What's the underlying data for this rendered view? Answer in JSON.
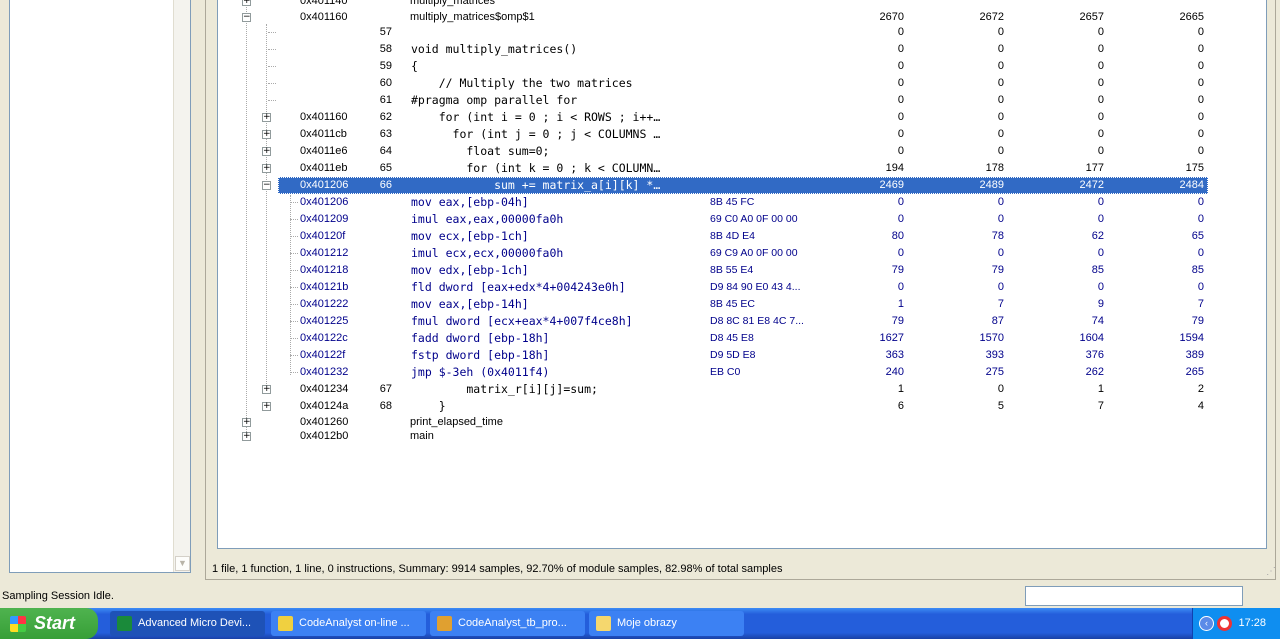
{
  "tree": {
    "columns_note": "",
    "rows": [
      {
        "kind": "func",
        "level": 1,
        "exp": "+",
        "addr": "0x401140",
        "line": "",
        "src": "multiply_matrices",
        "bytes": "",
        "vals": [
          "",
          "",
          "",
          ""
        ]
      },
      {
        "kind": "func",
        "level": 1,
        "exp": "-",
        "addr": "0x401160",
        "line": "",
        "src": "multiply_matrices$omp$1",
        "bytes": "",
        "vals": [
          "2670",
          "2672",
          "2657",
          "2665"
        ]
      },
      {
        "kind": "src",
        "level": 2,
        "exp": "",
        "addr": "",
        "line": "57",
        "src": "",
        "bytes": "",
        "vals": [
          "0",
          "0",
          "0",
          "0"
        ]
      },
      {
        "kind": "src",
        "level": 2,
        "exp": "",
        "addr": "",
        "line": "58",
        "src": "void multiply_matrices()",
        "bytes": "",
        "vals": [
          "0",
          "0",
          "0",
          "0"
        ]
      },
      {
        "kind": "src",
        "level": 2,
        "exp": "",
        "addr": "",
        "line": "59",
        "src": "{",
        "bytes": "",
        "vals": [
          "0",
          "0",
          "0",
          "0"
        ]
      },
      {
        "kind": "src",
        "level": 2,
        "exp": "",
        "addr": "",
        "line": "60",
        "src": "    // Multiply the two matrices",
        "bytes": "",
        "vals": [
          "0",
          "0",
          "0",
          "0"
        ]
      },
      {
        "kind": "src",
        "level": 2,
        "exp": "",
        "addr": "",
        "line": "61",
        "src": "#pragma omp parallel for",
        "bytes": "",
        "vals": [
          "0",
          "0",
          "0",
          "0"
        ]
      },
      {
        "kind": "src",
        "level": 2,
        "exp": "+",
        "addr": "0x401160",
        "line": "62",
        "src": "    for (int i = 0 ; i < ROWS ; i++…",
        "bytes": "",
        "vals": [
          "0",
          "0",
          "0",
          "0"
        ]
      },
      {
        "kind": "src",
        "level": 2,
        "exp": "+",
        "addr": "0x4011cb",
        "line": "63",
        "src": "      for (int j = 0 ; j < COLUMNS …",
        "bytes": "",
        "vals": [
          "0",
          "0",
          "0",
          "0"
        ]
      },
      {
        "kind": "src",
        "level": 2,
        "exp": "+",
        "addr": "0x4011e6",
        "line": "64",
        "src": "        float sum=0;",
        "bytes": "",
        "vals": [
          "0",
          "0",
          "0",
          "0"
        ]
      },
      {
        "kind": "src",
        "level": 2,
        "exp": "+",
        "addr": "0x4011eb",
        "line": "65",
        "src": "        for (int k = 0 ; k < COLUMN…",
        "bytes": "",
        "vals": [
          "194",
          "178",
          "177",
          "175"
        ]
      },
      {
        "kind": "src",
        "level": 2,
        "exp": "-",
        "addr": "0x401206",
        "line": "66",
        "src": "            sum += matrix_a[i][k] *…",
        "bytes": "",
        "vals": [
          "2469",
          "2489",
          "2472",
          "2484"
        ],
        "selected": true
      },
      {
        "kind": "asm",
        "level": 3,
        "exp": "",
        "addr": "0x401206",
        "line": "",
        "src": "mov eax,[ebp-04h]",
        "bytes": "8B 45 FC",
        "vals": [
          "0",
          "0",
          "0",
          "0"
        ]
      },
      {
        "kind": "asm",
        "level": 3,
        "exp": "",
        "addr": "0x401209",
        "line": "",
        "src": "imul eax,eax,00000fa0h",
        "bytes": "69 C0 A0 0F 00 00",
        "vals": [
          "0",
          "0",
          "0",
          "0"
        ]
      },
      {
        "kind": "asm",
        "level": 3,
        "exp": "",
        "addr": "0x40120f",
        "line": "",
        "src": "mov ecx,[ebp-1ch]",
        "bytes": "8B 4D E4",
        "vals": [
          "80",
          "78",
          "62",
          "65"
        ]
      },
      {
        "kind": "asm",
        "level": 3,
        "exp": "",
        "addr": "0x401212",
        "line": "",
        "src": "imul ecx,ecx,00000fa0h",
        "bytes": "69 C9 A0 0F 00 00",
        "vals": [
          "0",
          "0",
          "0",
          "0"
        ]
      },
      {
        "kind": "asm",
        "level": 3,
        "exp": "",
        "addr": "0x401218",
        "line": "",
        "src": "mov edx,[ebp-1ch]",
        "bytes": "8B 55 E4",
        "vals": [
          "79",
          "79",
          "85",
          "85"
        ]
      },
      {
        "kind": "asm",
        "level": 3,
        "exp": "",
        "addr": "0x40121b",
        "line": "",
        "src": "fld dword [eax+edx*4+004243e0h]",
        "bytes": "D9 84 90 E0 43 4...",
        "vals": [
          "0",
          "0",
          "0",
          "0"
        ]
      },
      {
        "kind": "asm",
        "level": 3,
        "exp": "",
        "addr": "0x401222",
        "line": "",
        "src": "mov eax,[ebp-14h]",
        "bytes": "8B 45 EC",
        "vals": [
          "1",
          "7",
          "9",
          "7"
        ]
      },
      {
        "kind": "asm",
        "level": 3,
        "exp": "",
        "addr": "0x401225",
        "line": "",
        "src": "fmul dword [ecx+eax*4+007f4ce8h]",
        "bytes": "D8 8C 81 E8 4C 7...",
        "vals": [
          "79",
          "87",
          "74",
          "79"
        ]
      },
      {
        "kind": "asm",
        "level": 3,
        "exp": "",
        "addr": "0x40122c",
        "line": "",
        "src": "fadd dword [ebp-18h]",
        "bytes": "D8 45 E8",
        "vals": [
          "1627",
          "1570",
          "1604",
          "1594"
        ]
      },
      {
        "kind": "asm",
        "level": 3,
        "exp": "",
        "addr": "0x40122f",
        "line": "",
        "src": "fstp dword [ebp-18h]",
        "bytes": "D9 5D E8",
        "vals": [
          "363",
          "393",
          "376",
          "389"
        ]
      },
      {
        "kind": "asm",
        "level": 3,
        "exp": "",
        "addr": "0x401232",
        "line": "",
        "src": "jmp $-3eh (0x4011f4)",
        "bytes": "EB C0",
        "vals": [
          "240",
          "275",
          "262",
          "265"
        ]
      },
      {
        "kind": "src",
        "level": 2,
        "exp": "+",
        "addr": "0x401234",
        "line": "67",
        "src": "        matrix_r[i][j]=sum;",
        "bytes": "",
        "vals": [
          "1",
          "0",
          "1",
          "2"
        ]
      },
      {
        "kind": "src",
        "level": 2,
        "exp": "+",
        "addr": "0x40124a",
        "line": "68",
        "src": "    }",
        "bytes": "",
        "vals": [
          "6",
          "5",
          "7",
          "4"
        ]
      },
      {
        "kind": "func",
        "level": 1,
        "exp": "+",
        "addr": "0x401260",
        "line": "",
        "src": "print_elapsed_time",
        "bytes": "",
        "vals": [
          "",
          "",
          "",
          ""
        ]
      },
      {
        "kind": "func",
        "level": 1,
        "exp": "+",
        "addr": "0x4012b0",
        "line": "",
        "src": "main",
        "bytes": "",
        "vals": [
          "",
          "",
          "",
          ""
        ]
      }
    ]
  },
  "summary": "1 file, 1 function, 1 line, 0 instructions, Summary: 9914 samples, 92.70% of module samples, 82.98% of total samples",
  "status": "Sampling Session Idle.",
  "taskbar": {
    "start": "Start",
    "tasks": [
      {
        "label": "Advanced Micro Devi...",
        "icon": "amd-app-icon",
        "color": "#1a8a3a",
        "active": true
      },
      {
        "label": "CodeAnalyst on-line ...",
        "icon": "help-icon",
        "color": "#f0d040",
        "active": false
      },
      {
        "label": "CodeAnalyst_tb_pro...",
        "icon": "paint-icon",
        "color": "#e0a030",
        "active": false
      },
      {
        "label": "Moje obrazy",
        "icon": "folder-icon",
        "color": "#f5d76e",
        "active": false
      }
    ],
    "clock": "17:28"
  }
}
